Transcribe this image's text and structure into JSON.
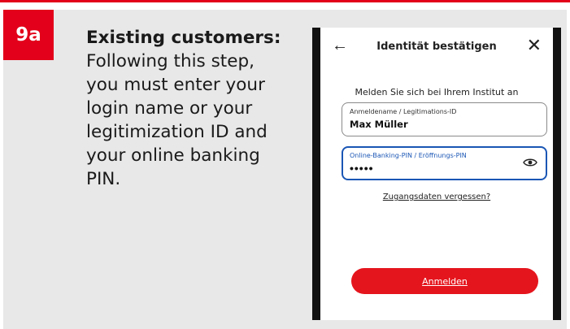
{
  "step": {
    "badge": "9a"
  },
  "instruction": {
    "heading": "Existing customers:",
    "lines": [
      "Following this step,",
      "you must enter your",
      "login name or your",
      "legitimization ID and",
      "your online banking",
      "PIN."
    ]
  },
  "phone": {
    "appbar": {
      "back_icon": "←",
      "title": "Identität bestätigen",
      "close_icon": "✕"
    },
    "subtitle": "Melden Sie sich bei Ihrem Institut an",
    "login_field": {
      "label": "Anmeldename / Legitimations-ID",
      "value": "Max Müller"
    },
    "pin_field": {
      "label": "Online-Banking-PIN / Eröffnungs-PIN",
      "value_masked": "•••••",
      "toggle_icon": "eye-icon"
    },
    "forgot_link": "Zugangsdaten vergessen?",
    "login_button": "Anmelden"
  },
  "colors": {
    "accent": "#e2001a",
    "button": "#e5151d",
    "focus": "#1a56b5",
    "card_bg": "#e8e8e8"
  }
}
